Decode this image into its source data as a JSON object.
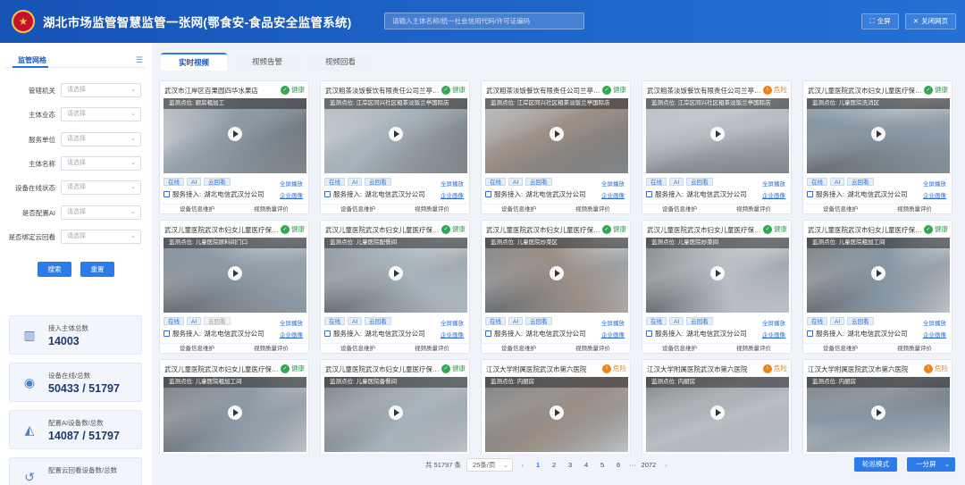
{
  "header": {
    "title": "湖北市场监管智慧监管一张网(鄂食安-食品安全监管系统)",
    "search_placeholder": "请输入主体名称/统一社会信用代码/许可证编码",
    "fullscreen_label": "全屏",
    "close_label": "关闭网页"
  },
  "sidebar": {
    "section_title": "监管网格",
    "filters": [
      {
        "label": "管辖机关",
        "placeholder": "请选择"
      },
      {
        "label": "主体业态",
        "placeholder": "请选择"
      },
      {
        "label": "服务单位",
        "placeholder": "请选择"
      },
      {
        "label": "主体名称",
        "placeholder": "请选择"
      },
      {
        "label": "设备在线状态",
        "placeholder": "请选择"
      },
      {
        "label": "是否配置AI",
        "placeholder": "请选择"
      },
      {
        "label": "是否绑定云回看",
        "placeholder": "请选择"
      }
    ],
    "search_label": "搜索",
    "reset_label": "重置",
    "stats": [
      {
        "label": "接入主体总数",
        "value": "14003",
        "icon": "building-icon"
      },
      {
        "label": "设备在线/总数",
        "value": "50433 / 51797",
        "icon": "camera-icon"
      },
      {
        "label": "配置AI设备数/总数",
        "value": "14087 / 51797",
        "icon": "cctv-icon"
      },
      {
        "label": "配置云回看设备数/总数",
        "value": "",
        "icon": "replay-icon"
      }
    ]
  },
  "tabs": [
    {
      "label": "实时视频",
      "active": true
    },
    {
      "label": "视频告警",
      "active": false
    },
    {
      "label": "视频回看",
      "active": false
    }
  ],
  "card_labels": {
    "online": "在线",
    "ai": "AI",
    "cloud": "云回看",
    "fullscreen": "全屏播放",
    "service_prefix": "服务接入: ",
    "enterprise": "企业画像",
    "device_maintain": "设备信息维护",
    "video_eval": "视频质量评价"
  },
  "cards": [
    {
      "title": "武汉市江岸区百果园四华水果店",
      "status": "健康",
      "status_type": "ok",
      "location": "监测点位: 厨房粗加工",
      "service": "湖北电信武汉分公司",
      "cloud_active": true
    },
    {
      "title": "武汉粗茶淡饭餐饮有限责任公司兰亭分...",
      "status": "健康",
      "status_type": "ok",
      "location": "监测点位: 江岸区同兴社区粗茶淡饭兰亭国际店",
      "service": "湖北电信武汉分公司",
      "cloud_active": true
    },
    {
      "title": "武汉粗茶淡饭餐饮有限责任公司兰亭分...",
      "status": "健康",
      "status_type": "ok",
      "location": "监测点位: 江岸区同兴社区粗茶淡饭兰亭国际店",
      "service": "湖北电信武汉分公司",
      "cloud_active": true
    },
    {
      "title": "武汉粗茶淡饭餐饮有限责任公司兰亭分...",
      "status": "危险",
      "status_type": "warn",
      "location": "监测点位: 江岸区同兴社区粗茶淡饭兰亭国际店",
      "service": "湖北电信武汉分公司",
      "cloud_active": true
    },
    {
      "title": "武汉儿童医院武汉市妇女儿童医疗保健...",
      "status": "健康",
      "status_type": "ok",
      "location": "监测点位: 儿童医院洗消区",
      "service": "湖北电信武汉分公司",
      "cloud_active": true
    },
    {
      "title": "武汉儿童医院武汉市妇女儿童医疗保健...",
      "status": "健康",
      "status_type": "ok",
      "location": "监测点位: 儿童医院原料间门口",
      "service": "湖北电信武汉分公司",
      "cloud_active": false
    },
    {
      "title": "武汉儿童医院武汉市妇女儿童医疗保健...",
      "status": "健康",
      "status_type": "ok",
      "location": "监测点位: 儿童医院配餐间",
      "service": "湖北电信武汉分公司",
      "cloud_active": true
    },
    {
      "title": "武汉儿童医院武汉市妇女儿童医疗保健...",
      "status": "健康",
      "status_type": "ok",
      "location": "监测点位: 儿童医院炒菜区",
      "service": "湖北电信武汉分公司",
      "cloud_active": true
    },
    {
      "title": "武汉儿童医院武汉市妇女儿童医疗保健...",
      "status": "健康",
      "status_type": "ok",
      "location": "监测点位: 儿童医院炒菜间",
      "service": "湖北电信武汉分公司",
      "cloud_active": true
    },
    {
      "title": "武汉儿童医院武汉市妇女儿童医疗保健...",
      "status": "健康",
      "status_type": "ok",
      "location": "监测点位: 儿童医院粗加工间",
      "service": "湖北电信武汉分公司",
      "cloud_active": true
    },
    {
      "title": "武汉儿童医院武汉市妇女儿童医疗保健...",
      "status": "健康",
      "status_type": "ok",
      "location": "监测点位: 儿童医院粗加工间",
      "service": "",
      "cloud_active": true
    },
    {
      "title": "武汉儿童医院武汉市妇女儿童医疗保健...",
      "status": "健康",
      "status_type": "ok",
      "location": "监测点位: 儿童医院备餐间",
      "service": "",
      "cloud_active": true
    },
    {
      "title": "江汉大学附属医院武汉市第六医院",
      "status": "危险",
      "status_type": "warn",
      "location": "监测点位: 内厨房",
      "service": "",
      "cloud_active": true
    },
    {
      "title": "江汉大学附属医院武汉市第六医院",
      "status": "危险",
      "status_type": "warn",
      "location": "监测点位: 内厨房",
      "service": "",
      "cloud_active": true
    },
    {
      "title": "江汉大学附属医院武汉市第六医院",
      "status": "危险",
      "status_type": "warn",
      "location": "监测点位: 内厨房",
      "service": "",
      "cloud_active": true
    }
  ],
  "pagination": {
    "total": "共 51797 条",
    "page_size": "25条/页",
    "pages": [
      "1",
      "2",
      "3",
      "4",
      "5",
      "6"
    ],
    "current": "1",
    "ellipsis": "···",
    "last": "2072"
  },
  "view_mode_label": "轮巡模式",
  "split_label": "一分屏",
  "colors": {
    "header": "#1e64c8",
    "accent": "#2b7be8",
    "healthy": "#2fa84f",
    "danger": "#e8831a"
  }
}
